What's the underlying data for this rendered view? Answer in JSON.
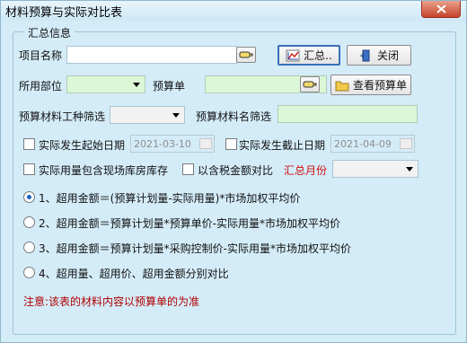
{
  "window": {
    "title": "材料预算与实际对比表"
  },
  "summary_group": {
    "legend": "汇总信息"
  },
  "fields": {
    "project_name_label": "项目名称",
    "project_name_value": "",
    "department_label": "所用部位",
    "department_value": "",
    "budget_label": "预算单",
    "budget_value": "",
    "material_type_label": "预算材料工种筛选",
    "material_type_value": "",
    "material_name_label": "预算材料名筛选",
    "material_name_value": ""
  },
  "buttons": {
    "summarize_label": "汇总..",
    "close_label": "关闭",
    "view_budget_label": "查看预算单"
  },
  "dates": {
    "start_label": "实际发生起始日期",
    "start_value": "2021-03-10",
    "end_label": "实际发生截止日期",
    "end_value": "2021-04-09"
  },
  "options": {
    "include_onsite_label": "实际用量包含现场库房库存",
    "tax_included_label": "以含税金额对比",
    "summary_month_label": "汇总月份",
    "summary_month_value": ""
  },
  "radios": [
    {
      "label": "1、超用金额＝(预算计划量-实际用量)*市场加权平均价",
      "selected": true
    },
    {
      "label": "2、超用金额＝预算计划量*预算单价-实际用量*市场加权平均价",
      "selected": false
    },
    {
      "label": "3、超用金额＝预算计划量*采购控制价-实际用量*市场加权平均价",
      "selected": false
    },
    {
      "label": "4、超用量、超用价、超用金额分别对比",
      "selected": false
    }
  ],
  "note": "注意:该表的材料内容以预算单的为准",
  "colors": {
    "window_bg": "#d4ecf8",
    "green_field": "#dcf7d6",
    "accent_red": "#d01010",
    "radio_selected": "#1f5fbf"
  },
  "icons": {
    "close_window": "close-x-icon",
    "summarize": "chart-icon",
    "close_button": "door-exit-icon",
    "view_budget": "folder-icon",
    "picker": "pointer-hand-icon",
    "dropdown": "chevron-down-icon"
  }
}
